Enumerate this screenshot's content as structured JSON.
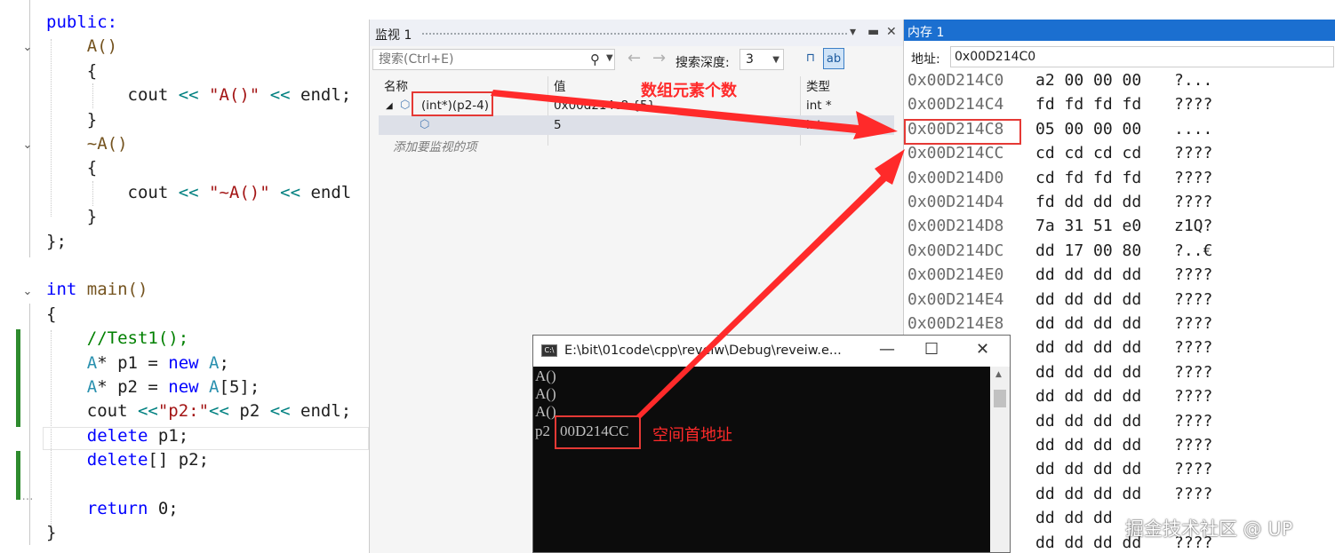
{
  "editor": {
    "lines": [
      [
        {
          "t": "public:",
          "c": "kw"
        }
      ],
      [
        {
          "t": "    A()",
          "c": "fn"
        }
      ],
      [
        {
          "t": "    {",
          "c": "tx"
        }
      ],
      [
        {
          "t": "        cout ",
          "c": "tx"
        },
        {
          "t": "<<",
          "c": "op"
        },
        {
          "t": " \"A()\" ",
          "c": "str"
        },
        {
          "t": "<<",
          "c": "op"
        },
        {
          "t": " endl;",
          "c": "tx"
        }
      ],
      [
        {
          "t": "    }",
          "c": "tx"
        }
      ],
      [
        {
          "t": "    ~A()",
          "c": "fn"
        }
      ],
      [
        {
          "t": "    {",
          "c": "tx"
        }
      ],
      [
        {
          "t": "        cout ",
          "c": "tx"
        },
        {
          "t": "<<",
          "c": "op"
        },
        {
          "t": " \"~A()\" ",
          "c": "str"
        },
        {
          "t": "<<",
          "c": "op"
        },
        {
          "t": " endl",
          "c": "tx"
        }
      ],
      [
        {
          "t": "    }",
          "c": "tx"
        }
      ],
      [
        {
          "t": "};",
          "c": "tx"
        }
      ],
      [],
      [
        {
          "t": "int",
          "c": "kw"
        },
        {
          "t": " main()",
          "c": "fn"
        }
      ],
      [
        {
          "t": "{",
          "c": "tx"
        }
      ],
      [
        {
          "t": "    //Test1();",
          "c": "cm"
        }
      ],
      [
        {
          "t": "    A",
          "c": "ty"
        },
        {
          "t": "* p1 = ",
          "c": "tx"
        },
        {
          "t": "new",
          "c": "kw"
        },
        {
          "t": " A",
          "c": "ty"
        },
        {
          "t": ";",
          "c": "tx"
        }
      ],
      [
        {
          "t": "    A",
          "c": "ty"
        },
        {
          "t": "* p2 = ",
          "c": "tx"
        },
        {
          "t": "new",
          "c": "kw"
        },
        {
          "t": " A",
          "c": "ty"
        },
        {
          "t": "[5];",
          "c": "tx"
        }
      ],
      [
        {
          "t": "    cout ",
          "c": "tx"
        },
        {
          "t": "<<",
          "c": "op"
        },
        {
          "t": "\"p2:\"",
          "c": "str"
        },
        {
          "t": "<<",
          "c": "op"
        },
        {
          "t": " p2 ",
          "c": "tx"
        },
        {
          "t": "<<",
          "c": "op"
        },
        {
          "t": " endl;",
          "c": "tx"
        }
      ],
      [
        {
          "t": "    delete",
          "c": "kw"
        },
        {
          "t": " p1;",
          "c": "tx"
        }
      ],
      [
        {
          "t": "    delete",
          "c": "kw"
        },
        {
          "t": "[] p2;",
          "c": "tx"
        }
      ],
      [],
      [
        {
          "t": "    return",
          "c": "kw"
        },
        {
          "t": " 0;",
          "c": "tx"
        }
      ],
      [
        {
          "t": "}",
          "c": "tx"
        }
      ]
    ]
  },
  "watch": {
    "title": "监视 1",
    "search_placeholder": "搜索(Ctrl+E)",
    "depth_label": "搜索深度:",
    "depth_value": "3",
    "columns": {
      "name": "名称",
      "value": "值",
      "type": "类型"
    },
    "rows": [
      {
        "name": "(int*)(p2-4)",
        "value": "0x00d214c8 {5}",
        "type": "int *"
      },
      {
        "name": "",
        "value": "5",
        "type": "int"
      }
    ],
    "add_watch": "添加要监视的项"
  },
  "memory": {
    "title": "内存 1",
    "address_label": "地址:",
    "address_value": "0x00D214C0",
    "rows": [
      {
        "addr": "0x00D214C0",
        "bytes": "a2 00 00 00",
        "ascii": "?..."
      },
      {
        "addr": "0x00D214C4",
        "bytes": "fd fd fd fd",
        "ascii": "????"
      },
      {
        "addr": "0x00D214C8",
        "bytes": "05 00 00 00",
        "ascii": "...."
      },
      {
        "addr": "0x00D214CC",
        "bytes": "cd cd cd cd",
        "ascii": "????"
      },
      {
        "addr": "0x00D214D0",
        "bytes": "cd fd fd fd",
        "ascii": "????"
      },
      {
        "addr": "0x00D214D4",
        "bytes": "fd dd dd dd",
        "ascii": "????"
      },
      {
        "addr": "0x00D214D8",
        "bytes": "7a 31 51 e0",
        "ascii": "z1Q?"
      },
      {
        "addr": "0x00D214DC",
        "bytes": "dd 17 00 80",
        "ascii": "?..€"
      },
      {
        "addr": "0x00D214E0",
        "bytes": "dd dd dd dd",
        "ascii": "????"
      },
      {
        "addr": "0x00D214E4",
        "bytes": "dd dd dd dd",
        "ascii": "????"
      },
      {
        "addr": "0x00D214E8",
        "bytes": "dd dd dd dd",
        "ascii": "????"
      },
      {
        "addr": "",
        "bytes": "dd dd dd dd",
        "ascii": "????"
      },
      {
        "addr": "",
        "bytes": "dd dd dd dd",
        "ascii": "????"
      },
      {
        "addr": "",
        "bytes": "dd dd dd dd",
        "ascii": "????"
      },
      {
        "addr": "",
        "bytes": "dd dd dd dd",
        "ascii": "????"
      },
      {
        "addr": "",
        "bytes": "dd dd dd dd",
        "ascii": "????"
      },
      {
        "addr": "",
        "bytes": "dd dd dd dd",
        "ascii": "????"
      },
      {
        "addr": "",
        "bytes": "dd dd dd dd",
        "ascii": "????"
      },
      {
        "addr": "",
        "bytes": "dd dd dd",
        "ascii": ""
      },
      {
        "addr": "",
        "bytes": "dd dd dd dd",
        "ascii": "????"
      }
    ]
  },
  "console": {
    "title": "E:\\bit\\01code\\cpp\\reveiw\\Debug\\reveiw.e...",
    "lines": [
      "A()",
      "A()",
      "A()"
    ],
    "p2_label": "p2",
    "p2_value": "00D214CC"
  },
  "annotations": {
    "array_count": "数组元素个数",
    "space_start": "空间首地址"
  },
  "watermark": "掘金技术社区 @ UP",
  "colors": {
    "accent_red": "#ff2a2a",
    "memory_title_bg": "#1b6fd0",
    "change_bar": "#2e8b2e"
  }
}
